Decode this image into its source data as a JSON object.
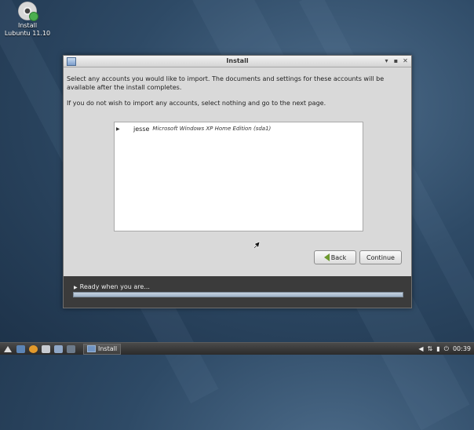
{
  "desktop": {
    "icon_label_line1": "Install",
    "icon_label_line2": "Lubuntu 11.10",
    "icon": "cd-disc-icon"
  },
  "window": {
    "title": "Install",
    "controls": [
      "minimize",
      "maximize",
      "close"
    ],
    "description": "Select any accounts you would like to import.  The documents and settings for these accounts will be available after the install completes.",
    "hint": "If you do not wish to import any accounts, select nothing and go to the next page.",
    "accounts": [
      {
        "user": "jesse",
        "os": "Microsoft Windows XP Home Edition (sda1)"
      }
    ],
    "buttons": {
      "back": "Back",
      "continue": "Continue"
    },
    "status": "Ready when you are..."
  },
  "taskbar": {
    "task_label": "Install",
    "clock": "00:39"
  },
  "colors": {
    "window_bg": "#d9d9d9",
    "status_bg": "#3b3b3b",
    "desktop": "#2e4a66",
    "back_arrow": "#6e9a2f"
  }
}
